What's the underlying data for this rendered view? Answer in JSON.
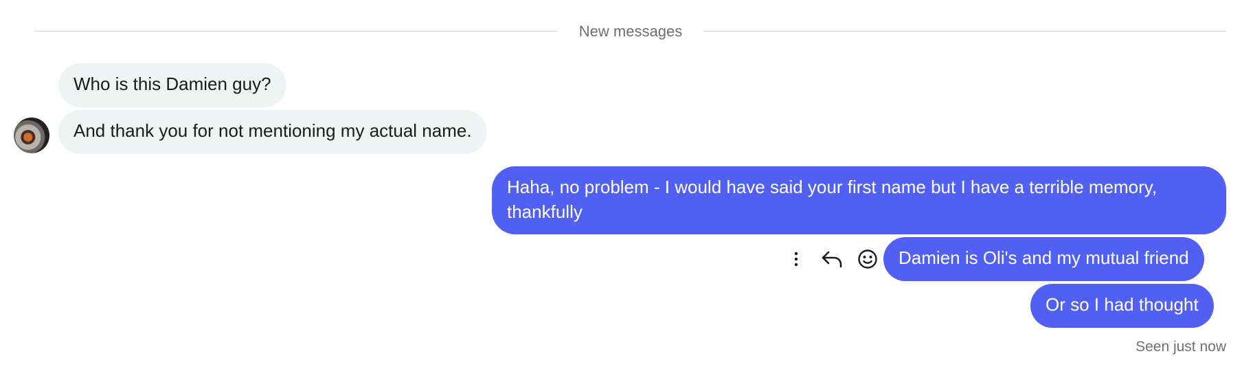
{
  "divider": {
    "label": "New messages"
  },
  "incoming": {
    "messages": [
      "Who is this Damien guy?",
      "And thank you for not mentioning my actual name."
    ],
    "avatar_icon": "user-avatar-photo"
  },
  "outgoing": {
    "messages": [
      "Haha, no problem - I would have said your first name but I have a terrible memory, thankfully",
      "Damien is Oli's and my mutual friend",
      "Or so I had thought"
    ]
  },
  "message_actions": {
    "icons": [
      "more-vertical-icon",
      "reply-icon",
      "emoji-reaction-icon"
    ]
  },
  "status": {
    "seen": "Seen just now"
  },
  "colors": {
    "outgoing_bubble": "#5160f2",
    "incoming_bubble": "#f0f3f4",
    "muted_text": "#6b6f73"
  }
}
